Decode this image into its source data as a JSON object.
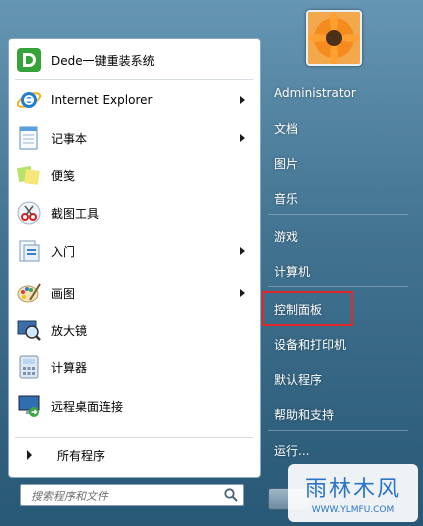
{
  "left_panel": {
    "apps": [
      {
        "label": "Dede一键重装系统",
        "icon": "green-d-app-icon"
      },
      {
        "label": "Internet Explorer",
        "icon": "internet-explorer-icon",
        "arrow": true
      },
      {
        "label": "记事本",
        "icon": "notepad-icon",
        "arrow": true
      },
      {
        "label": "便笺",
        "icon": "sticky-notes-icon"
      },
      {
        "label": "截图工具",
        "icon": "snipping-tool-icon"
      },
      {
        "label": "入门",
        "icon": "getting-started-icon",
        "arrow": true
      },
      {
        "label": "画图",
        "icon": "paint-icon",
        "arrow": true
      },
      {
        "label": "放大镜",
        "icon": "magnifier-icon"
      },
      {
        "label": "计算器",
        "icon": "calculator-icon"
      },
      {
        "label": "远程桌面连接",
        "icon": "remote-desktop-icon"
      }
    ],
    "all_programs": "所有程序",
    "search_placeholder": "搜索程序和文件"
  },
  "right_panel": {
    "items": [
      {
        "label": "Administrator"
      },
      {
        "label": "文档"
      },
      {
        "label": "图片"
      },
      {
        "label": "音乐"
      },
      {
        "label": "游戏"
      },
      {
        "label": "计算机"
      },
      {
        "label": "控制面板",
        "highlighted": true
      },
      {
        "label": "设备和打印机"
      },
      {
        "label": "默认程序"
      },
      {
        "label": "帮助和支持"
      },
      {
        "label": "运行..."
      }
    ]
  },
  "watermark": {
    "title": "雨林木风",
    "url": "WWW.YLMFU.COM"
  },
  "colors": {
    "highlight_border": "#e22828",
    "right_panel_text": "#ffffff",
    "menu_glass": "#2f5f7d"
  }
}
